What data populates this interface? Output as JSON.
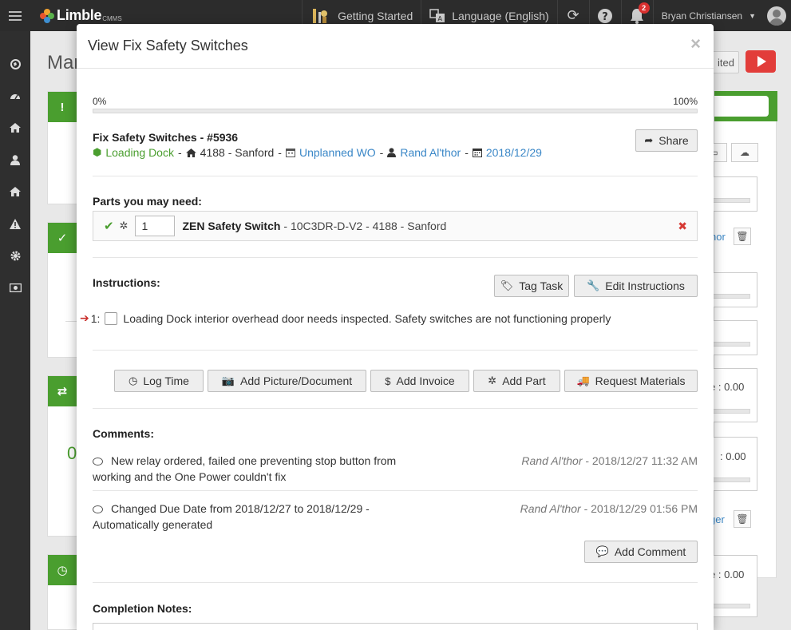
{
  "app": {
    "brand": "Limble",
    "brand_sub": "CMMS"
  },
  "topbar": {
    "getting_started": "Getting Started",
    "language": "Language (English)",
    "notification_count": "2",
    "user_name": "Bryan Christiansen"
  },
  "background": {
    "page_title_partial": "Mar",
    "partial_button": "ited",
    "partial_link_1": "hor",
    "partial_link_2": "ger",
    "partial_value_1": "e : 0.00",
    "partial_value_2": ": 0.00",
    "partial_value_3": "e : 0.00",
    "partial_green_digit": "0"
  },
  "modal": {
    "title": "View Fix Safety Switches",
    "close_glyph": "×",
    "progress": {
      "start_label": "0%",
      "end_label": "100%",
      "value_percent": 0
    },
    "task": {
      "name": "Fix Safety Switches - #5936",
      "location": "Loading Dock",
      "asset": "4188 - Sanford",
      "type": "Unplanned WO",
      "assignee": "Rand Al'thor",
      "due_date": "2018/12/29",
      "separator": "-"
    },
    "share_label": "Share",
    "parts": {
      "label": "Parts you may need:",
      "items": [
        {
          "quantity": "1",
          "name": "ZEN Safety Switch",
          "details": "- 10C3DR-D-V2 - 4188 - Sanford"
        }
      ]
    },
    "instructions": {
      "label": "Instructions:",
      "tag_task_label": "Tag Task",
      "edit_label": "Edit Instructions",
      "items": [
        {
          "number": "1:",
          "text": "Loading Dock interior overhead door needs inspected. Safety switches are not functioning properly"
        }
      ]
    },
    "actions": {
      "log_time": "Log Time",
      "add_picture": "Add Picture/Document",
      "add_invoice": "Add Invoice",
      "add_part": "Add Part",
      "request_materials": "Request Materials"
    },
    "comments": {
      "label": "Comments:",
      "items": [
        {
          "line1": "New relay ordered, failed one preventing stop button from",
          "line2": "working and the One Power couldn't fix",
          "author": "Rand Al'thor",
          "timestamp": "- 2018/12/27 11:32 AM"
        },
        {
          "line1": "Changed Due Date from 2018/12/27 to 2018/12/29 -",
          "line2": "Automatically generated",
          "author": "Rand Al'thor",
          "timestamp": "- 2018/12/29 01:56 PM"
        }
      ],
      "add_label": "Add Comment"
    },
    "completion_notes_label": "Completion Notes:"
  },
  "colors": {
    "accent_green": "#4a9e2f",
    "link_blue": "#3a87c7",
    "danger_red": "#d63a35",
    "topbar_bg": "#2c2c2c"
  },
  "icons": {
    "location": "cube-icon",
    "asset": "home-icon",
    "type": "calendar-icon",
    "assignee": "user-icon",
    "due_date": "calendar-icon"
  }
}
